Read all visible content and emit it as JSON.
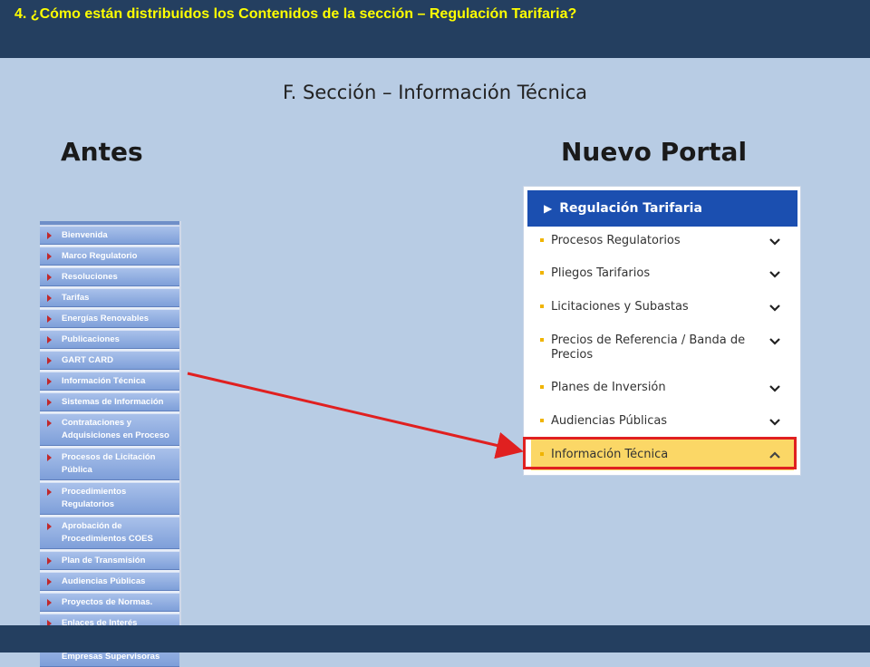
{
  "header": {
    "title": "4. ¿Cómo están distribuidos los Contenidos de la sección –  Regulación Tarifaria?"
  },
  "subtitle": "F. Sección – Información Técnica",
  "columns": {
    "before": "Antes",
    "after": "Nuevo Portal"
  },
  "old_menu": {
    "items": [
      "Bienvenida",
      "Marco Regulatorio",
      "Resoluciones",
      "Tarifas",
      "Energías Renovables",
      "Publicaciones",
      "GART CARD",
      "Información Técnica",
      "Sistemas de Información",
      "Contrataciones y Adquisiciones en Proceso",
      "Procesos de Licitación Pública",
      "Procedimientos Regulatorios",
      "Aprobación de Procedimientos COES",
      "Plan de Transmisión",
      "Audiencias Públicas",
      "Proyectos de Normas.",
      "Enlaces de Interés",
      "Proceso de Selección Empresas Supervisoras"
    ]
  },
  "new_menu": {
    "title": "Regulación Tarifaria",
    "items": [
      "Procesos Regulatorios",
      "Pliegos Tarifarios",
      "Licitaciones y Subastas",
      "Precios de Referencia / Banda de Precios",
      "Planes de Inversión",
      "Audiencias Públicas",
      "Información Técnica"
    ]
  },
  "colors": {
    "background": "#b8cce4",
    "bar": "#243f60",
    "title_text": "#ffff00",
    "portal_header": "#1b4fb0",
    "active_item": "#fbd766",
    "highlight": "#e02020"
  }
}
